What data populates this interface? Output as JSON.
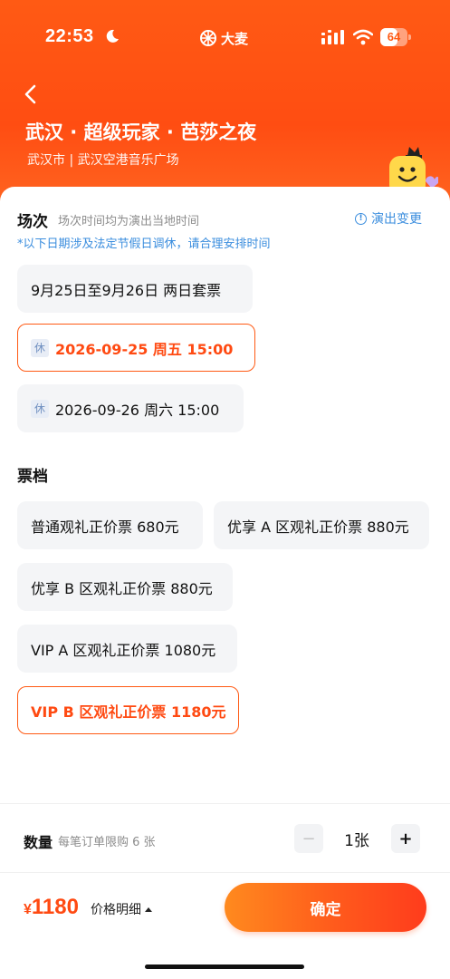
{
  "status_bar": {
    "time": "22:53",
    "brand": "大麦",
    "battery": "64",
    "battery_level": 0.64
  },
  "header": {
    "title": "武汉 · 超级玩家 · 芭莎之夜",
    "venue": "武汉市 | 武汉空港音乐广场"
  },
  "sessions": {
    "label": "场次",
    "note": "场次时间均为演出当地时间",
    "change_link": "演出变更",
    "holiday_note": "*以下日期涉及法定节假日调休，请合理安排时间",
    "rest_badge": "休",
    "items": [
      {
        "label": "9月25日至9月26日 两日套票",
        "selected": false,
        "rest": false
      },
      {
        "label": "2026-09-25  周五 15:00",
        "selected": true,
        "rest": true
      },
      {
        "label": "2026-09-26  周六 15:00",
        "selected": false,
        "rest": true
      }
    ]
  },
  "tickets": {
    "label": "票档",
    "items": [
      {
        "label": "普通观礼正价票 680元",
        "selected": false
      },
      {
        "label": "优享 A 区观礼正价票 880元",
        "selected": false
      },
      {
        "label": "优享 B 区观礼正价票 880元",
        "selected": false
      },
      {
        "label": "VIP A 区观礼正价票 1080元",
        "selected": false
      },
      {
        "label": "VIP B 区观礼正价票 1180元",
        "selected": true
      }
    ]
  },
  "quantity": {
    "label": "数量",
    "note": "每笔订单限购 6 张",
    "minus": "−",
    "plus": "+",
    "value": "1张"
  },
  "footer": {
    "price_symbol": "¥",
    "price_value": "1180",
    "price_detail": "价格明细",
    "confirm": "确定"
  },
  "colors": {
    "brand_orange": "#ff5a14",
    "selected_text": "#ff4a12",
    "link_blue": "#3a8dde"
  }
}
